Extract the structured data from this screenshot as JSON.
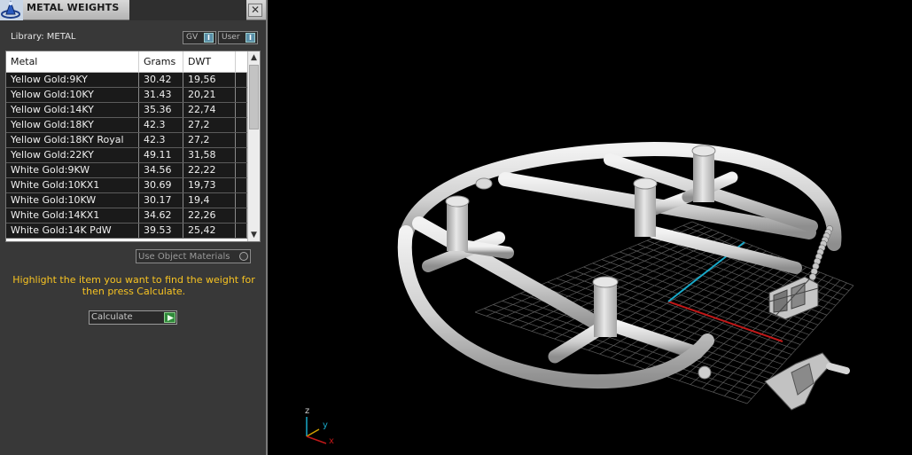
{
  "window": {
    "title": "METAL WEIGHTS",
    "close_glyph": "✕",
    "logo_icon": "app-logo-icon"
  },
  "library": {
    "label": "Library: METAL",
    "toggles": [
      {
        "label": "GV",
        "knob": "I"
      },
      {
        "label": "User",
        "knob": "I"
      }
    ]
  },
  "table": {
    "columns": [
      "Metal",
      "Grams",
      "DWT"
    ],
    "rows": [
      {
        "metal": "Yellow Gold:9KY",
        "grams": "30.42",
        "dwt": "19,56"
      },
      {
        "metal": "Yellow Gold:10KY",
        "grams": "31.43",
        "dwt": "20,21"
      },
      {
        "metal": "Yellow Gold:14KY",
        "grams": "35.36",
        "dwt": "22,74"
      },
      {
        "metal": "Yellow Gold:18KY",
        "grams": "42.3",
        "dwt": "27,2"
      },
      {
        "metal": "Yellow Gold:18KY Royal",
        "grams": "42.3",
        "dwt": "27,2"
      },
      {
        "metal": "Yellow Gold:22KY",
        "grams": "49.11",
        "dwt": "31,58"
      },
      {
        "metal": "White Gold:9KW",
        "grams": "34.56",
        "dwt": "22,22"
      },
      {
        "metal": "White Gold:10KX1",
        "grams": "30.69",
        "dwt": "19,73"
      },
      {
        "metal": "White Gold:10KW",
        "grams": "30.17",
        "dwt": "19,4"
      },
      {
        "metal": "White Gold:14KX1",
        "grams": "34.62",
        "dwt": "22,26"
      },
      {
        "metal": "White Gold:14K PdW",
        "grams": "39.53",
        "dwt": "25,42"
      }
    ],
    "scroll_up_glyph": "▲",
    "scroll_down_glyph": "▼"
  },
  "options": {
    "use_object_materials": "Use Object Materials"
  },
  "instruction": "Highlight the item you want to find the weight for then press Calculate.",
  "action": {
    "calculate_label": "Calculate"
  },
  "viewport": {
    "axes": {
      "z": "z",
      "y": "y",
      "x": "x"
    },
    "colors": {
      "background": "#000000",
      "grid": "#5a5a5a",
      "model": "#d4d4d4",
      "x_axis": "#c01818",
      "y_axis": "#18a8c8"
    }
  }
}
